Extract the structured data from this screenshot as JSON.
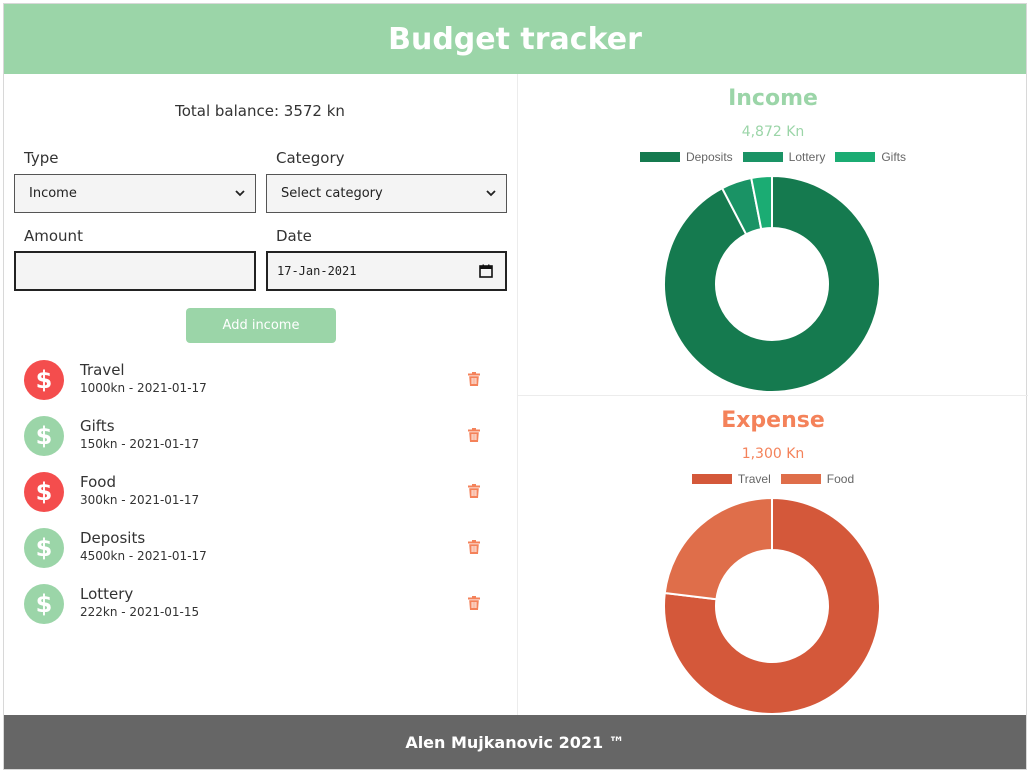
{
  "header": {
    "title": "Budget tracker"
  },
  "balance": {
    "text": "Total balance: 3572 kn"
  },
  "form": {
    "type_label": "Type",
    "type_value": "Income",
    "category_label": "Category",
    "category_value": "Select category",
    "amount_label": "Amount",
    "amount_value": "",
    "date_label": "Date",
    "date_value": "17-Jan-2021",
    "add_button": "Add income"
  },
  "transactions": [
    {
      "name": "Travel",
      "meta": "1000kn - 2021-01-17",
      "kind": "expense",
      "coin_color": "#f44d4d"
    },
    {
      "name": "Gifts",
      "meta": "150kn - 2021-01-17",
      "kind": "income",
      "coin_color": "#9bd5a8"
    },
    {
      "name": "Food",
      "meta": "300kn - 2021-01-17",
      "kind": "expense",
      "coin_color": "#f44d4d"
    },
    {
      "name": "Deposits",
      "meta": "4500kn - 2021-01-17",
      "kind": "income",
      "coin_color": "#9bd5a8"
    },
    {
      "name": "Lottery",
      "meta": "222kn - 2021-01-15",
      "kind": "income",
      "coin_color": "#9bd5a8"
    }
  ],
  "income": {
    "title": "Income",
    "total": "4,872 Kn",
    "color": "#9bd5a8"
  },
  "expense": {
    "title": "Expense",
    "total": "1,300 Kn",
    "color": "#f4825a"
  },
  "chart_data": [
    {
      "type": "pie",
      "title": "Income",
      "categories": [
        "Deposits",
        "Lottery",
        "Gifts"
      ],
      "values": [
        4500,
        222,
        150
      ],
      "colors": [
        "#157a4f",
        "#1a9365",
        "#1bac73"
      ],
      "legend": "top"
    },
    {
      "type": "pie",
      "title": "Expense",
      "categories": [
        "Travel",
        "Food"
      ],
      "values": [
        1000,
        300
      ],
      "colors": [
        "#d4583a",
        "#df6e4a"
      ],
      "legend": "top"
    }
  ],
  "footer": {
    "text": "Alen Mujkanovic 2021 ™"
  },
  "icons": {
    "coin": "dollar-icon",
    "delete": "trash-icon",
    "select": "chevron-down-icon",
    "date": "calendar-icon"
  },
  "colors": {
    "accent": "#9bd5a8",
    "expense": "#f4825a",
    "danger": "#f44d4d",
    "footer": "#666666"
  }
}
